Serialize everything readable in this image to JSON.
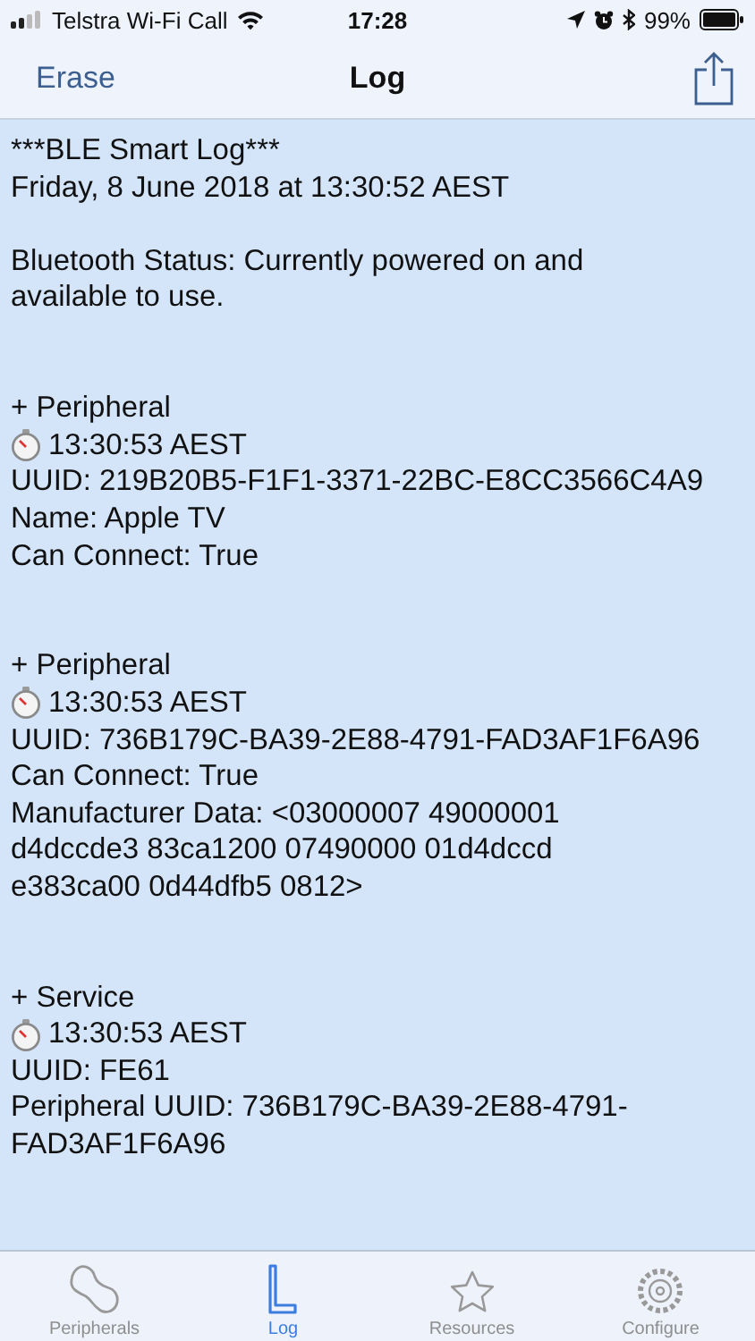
{
  "status_bar": {
    "carrier": "Telstra Wi-Fi Call",
    "time": "17:28",
    "battery": "99%"
  },
  "nav_bar": {
    "left_button": "Erase",
    "title": "Log"
  },
  "log": [
    {
      "lines": [
        {
          "kind": "text",
          "text": "***BLE Smart Log***"
        },
        {
          "kind": "text",
          "text": "Friday, 8 June 2018 at 13:30:52 AEST"
        }
      ]
    },
    {
      "lines": [
        {
          "kind": "text",
          "text": "Bluetooth Status: Currently powered on and"
        },
        {
          "kind": "text",
          "text": "available to use."
        }
      ]
    },
    {
      "lines": [
        {
          "kind": "text",
          "text": "+ Peripheral"
        },
        {
          "kind": "timestamp",
          "text": "13:30:53 AEST"
        },
        {
          "kind": "text",
          "text": "UUID: 219B20B5-F1F1-3371-22BC-E8CC3566C4A9"
        },
        {
          "kind": "text",
          "text": "Name: Apple TV"
        },
        {
          "kind": "text",
          "text": "Can Connect: True"
        }
      ]
    },
    {
      "lines": [
        {
          "kind": "text",
          "text": "+ Peripheral"
        },
        {
          "kind": "timestamp",
          "text": "13:30:53 AEST"
        },
        {
          "kind": "text",
          "text": "UUID: 736B179C-BA39-2E88-4791-FAD3AF1F6A96"
        },
        {
          "kind": "text",
          "text": "Can Connect: True"
        },
        {
          "kind": "text",
          "text": "Manufacturer Data: <03000007 49000001"
        },
        {
          "kind": "text",
          "text": "d4dccde3 83ca1200 07490000 01d4dccd"
        },
        {
          "kind": "text",
          "text": "e383ca00 0d44dfb5 0812>"
        }
      ]
    },
    {
      "lines": [
        {
          "kind": "text",
          "text": "+ Service"
        },
        {
          "kind": "timestamp",
          "text": "13:30:53 AEST"
        },
        {
          "kind": "text",
          "text": "UUID: FE61"
        },
        {
          "kind": "text",
          "text": "Peripheral UUID: 736B179C-BA39-2E88-4791-"
        },
        {
          "kind": "text",
          "text": "FAD3AF1F6A96"
        }
      ]
    }
  ],
  "tab_bar": [
    {
      "kind": "peripherals",
      "label": "Peripherals",
      "selected": false
    },
    {
      "kind": "log",
      "label": "Log",
      "selected": true
    },
    {
      "kind": "resources",
      "label": "Resources",
      "selected": false
    },
    {
      "kind": "configure",
      "label": "Configure",
      "selected": false
    }
  ]
}
